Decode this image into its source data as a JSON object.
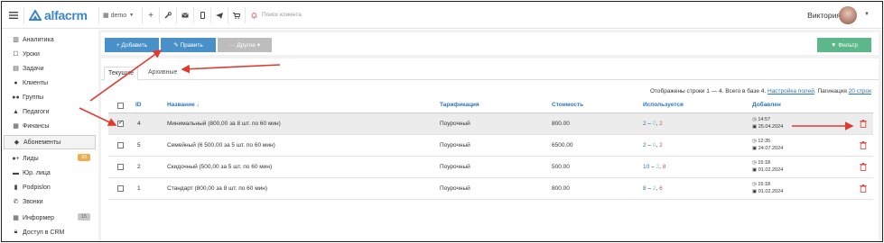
{
  "topbar": {
    "menu_icon": "hamburger-icon",
    "brand": "alfacrm",
    "branch": "demo",
    "search_placeholder": "Поиск клиента",
    "user_name": "Виктория"
  },
  "sidebar": {
    "items": [
      {
        "label": "Аналитика",
        "icon": "analytics-icon"
      },
      {
        "label": "Уроки",
        "icon": "calendar-icon"
      },
      {
        "label": "Задачи",
        "icon": "tasks-icon"
      },
      {
        "label": "Клиенты",
        "icon": "user-icon"
      },
      {
        "label": "Группы",
        "icon": "group-icon"
      },
      {
        "label": "Педагоги",
        "icon": "graduation-cap-icon"
      },
      {
        "label": "Финансы",
        "icon": "finance-icon"
      },
      {
        "label": "Абонементы",
        "icon": "tag-icon"
      },
      {
        "label": "Лиды",
        "icon": "leads-icon",
        "badge": "33",
        "badge_color": "#f0ad4e"
      },
      {
        "label": "Юр. лица",
        "icon": "briefcase-icon"
      },
      {
        "label": "Podpislon",
        "icon": "document-icon"
      },
      {
        "label": "Звонки",
        "icon": "phone-icon"
      },
      {
        "label": "Информер",
        "icon": "informer-icon",
        "badge": "15",
        "badge_color": "#bdbdbd"
      },
      {
        "label": "Доступ в CRM",
        "icon": "lock-icon"
      }
    ]
  },
  "toolbar": {
    "add_label": "+ Добавить",
    "edit_label": "✎ Править",
    "other_label": "··· Другое ▾",
    "filter_label": "▼ Фильтр"
  },
  "tabs": {
    "current": "Текущие",
    "archived": "Архивные"
  },
  "pager": {
    "info": "Отображены строки 1 — 4. Всего в базе 4.",
    "settings_link": "Настройка полей",
    "pagination_label": "Пагинация",
    "pagination_link": "20 строк"
  },
  "table": {
    "headers": {
      "id": "ID",
      "name": "Название ↓",
      "tariff": "Тарификация",
      "cost": "Стоимость",
      "used": "Используется",
      "added": "Добавлен"
    },
    "rows": [
      {
        "id": "4",
        "name": "Минимальный (800,00 за 8 шт. по 60 мин)",
        "tariff": "Поурочный",
        "cost": "800.00",
        "used_a": "2",
        "used_b": "0",
        "used_c": "2",
        "time": "14:57",
        "date": "25.04.2024",
        "checked": true
      },
      {
        "id": "5",
        "name": "Семейный (6 500,00 за 5 шт. по 60 мин)",
        "tariff": "Поурочный",
        "cost": "6500.00",
        "used_a": "2",
        "used_b": "0",
        "used_c": "2",
        "time": "12:35",
        "date": "24.07.2024",
        "checked": false
      },
      {
        "id": "2",
        "name": "Скидочный (500,00 за 5 шт. по 60 мин)",
        "tariff": "Поурочный",
        "cost": "500.00",
        "used_a": "10",
        "used_b": "2",
        "used_c": "8",
        "time": "15:18",
        "date": "01.02.2024",
        "checked": false
      },
      {
        "id": "1",
        "name": "Стандарт (800,00 за 8 шт. по 60 мин)",
        "tariff": "Поурочный",
        "cost": "800.00",
        "used_a": "8",
        "used_b": "2",
        "used_c": "6",
        "time": "15:18",
        "date": "01.02.2024",
        "checked": false
      }
    ]
  },
  "colors": {
    "primary": "#4a90c8",
    "success": "#5cb88a",
    "disabled": "#bdbdbd",
    "danger": "#d9534f",
    "annotation": "#e03a2f"
  }
}
